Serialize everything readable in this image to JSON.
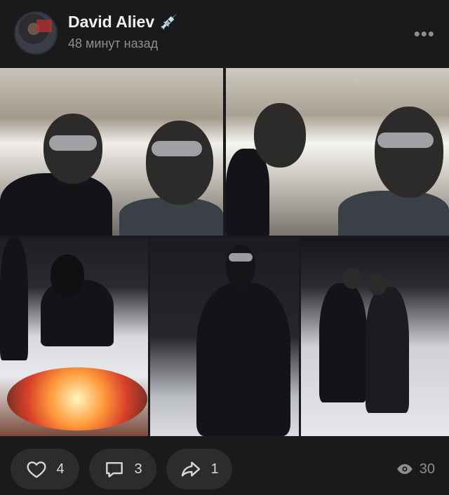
{
  "post": {
    "author_name": "David Aliev",
    "author_emoji": "💉",
    "time_ago": "48 минут назад",
    "more_icon": "ellipsis-icon"
  },
  "actions": {
    "likes": "4",
    "comments": "3",
    "shares": "1",
    "views": "30"
  },
  "colors": {
    "background": "#1a1a1c",
    "pill": "#2c2c2e",
    "muted": "#8e8e93"
  }
}
